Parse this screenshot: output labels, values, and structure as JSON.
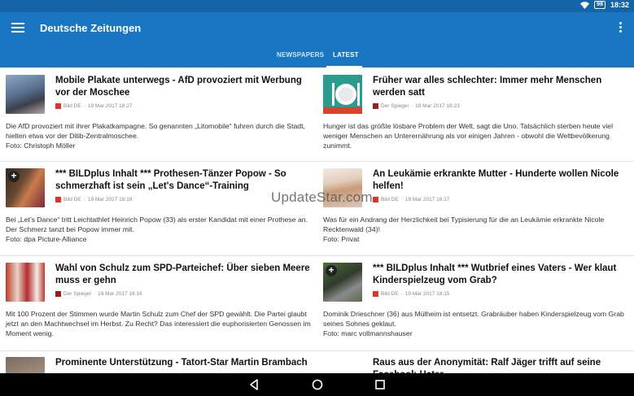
{
  "status_bar": {
    "battery": "98",
    "time": "18:32"
  },
  "app": {
    "title": "Deutsche Zeitungen"
  },
  "tabs": [
    {
      "label": "NEWSPAPERS",
      "active": false
    },
    {
      "label": "LATEST",
      "active": true
    }
  ],
  "articles": [
    {
      "headline": "Mobile Plakate unterwegs - AfD provoziert mit Werbung vor der Moschee",
      "source": "Bild DE",
      "date": "19 Mar 2017 18:27",
      "description": "Die AfD provoziert mit ihrer Plakatkampagne. So genannten „Litomobile“ fuhren durch die Stadt, hielten etwa vor der Ditib-Zentralmoschee.",
      "caption": "Foto: Christoph Möller"
    },
    {
      "headline": "Früher war alles schlechter: Immer mehr Menschen werden satt",
      "source": "Der Spiegel",
      "date": "19 Mar 2017 18:23",
      "description": "Hunger ist das größte lösbare Problem der Welt, sagt die Uno. Tatsächlich sterben heute viel weniger Menschen an Unterernährung als vor einigen Jahren - obwohl die Weltbevölkerung zunimmt.",
      "caption": ""
    },
    {
      "headline": "*** BILDplus Inhalt *** Prothesen-Tänzer Popow - So schmerzhaft ist sein „Let's Dance“-Training",
      "source": "Bild DE",
      "date": "19 Mar 2017 18:19",
      "description": "Bei „Let's Dance“ tritt Leichtathlet Heinrich Popow (33) als erster Kandidat mit einer Prothese an. Der Schmerz tanzt bei Popow immer mit.",
      "caption": "Foto: dpa Picture-Alliance"
    },
    {
      "headline": "An Leukämie erkrankte Mutter - Hunderte wollen Nicole helfen!",
      "source": "Bild DE",
      "date": "19 Mar 2017 18:17",
      "description": "Was für ein Andrang der Herzlichkeit bei Typisierung für die an Leukämie erkrankte Nicole Recktenwald (34)!",
      "caption": "Foto: Privat"
    },
    {
      "headline": "Wahl von Schulz zum SPD-Parteichef: Über sieben Meere muss er gehn",
      "source": "Der Spiegel",
      "date": "19 Mar 2017 18:16",
      "description": "Mit 100 Prozent der Stimmen wurde Martin Schulz zum Chef der SPD gewählt. Die Partei glaubt jetzt an den Machtwechsel im Herbst. Zu Recht? Das interessiert die euphorisierten Genossen im Moment wenig.",
      "caption": ""
    },
    {
      "headline": "*** BILDplus Inhalt *** Wutbrief eines Vaters - Wer klaut Kinderspielzeug  vom Grab?",
      "source": "Bild DE",
      "date": "19 Mar 2017 18:15",
      "description": "Dominik Drieschner (36) aus Mülheim ist entsetzt. Grabräuber haben Kinderspielzeug vom Grab seines Sohnes geklaut.",
      "caption": "Foto: marc vollmannshauser"
    },
    {
      "headline": "Prominente Unterstützung - Tatort-Star Martin Brambach",
      "source": "",
      "date": "",
      "description": "",
      "caption": ""
    },
    {
      "headline": "Raus aus der Anonymität: Ralf Jäger trifft auf seine Facebook-Hater",
      "source": "",
      "date": "",
      "description": "",
      "caption": ""
    }
  ],
  "watermark": "UpdateStar.com",
  "colors": {
    "status_bar": "#1565a6",
    "app_bar": "#1976c2",
    "nav_bar": "#000000",
    "bild": "#e0342a",
    "spiegel": "#9e1b1b"
  }
}
